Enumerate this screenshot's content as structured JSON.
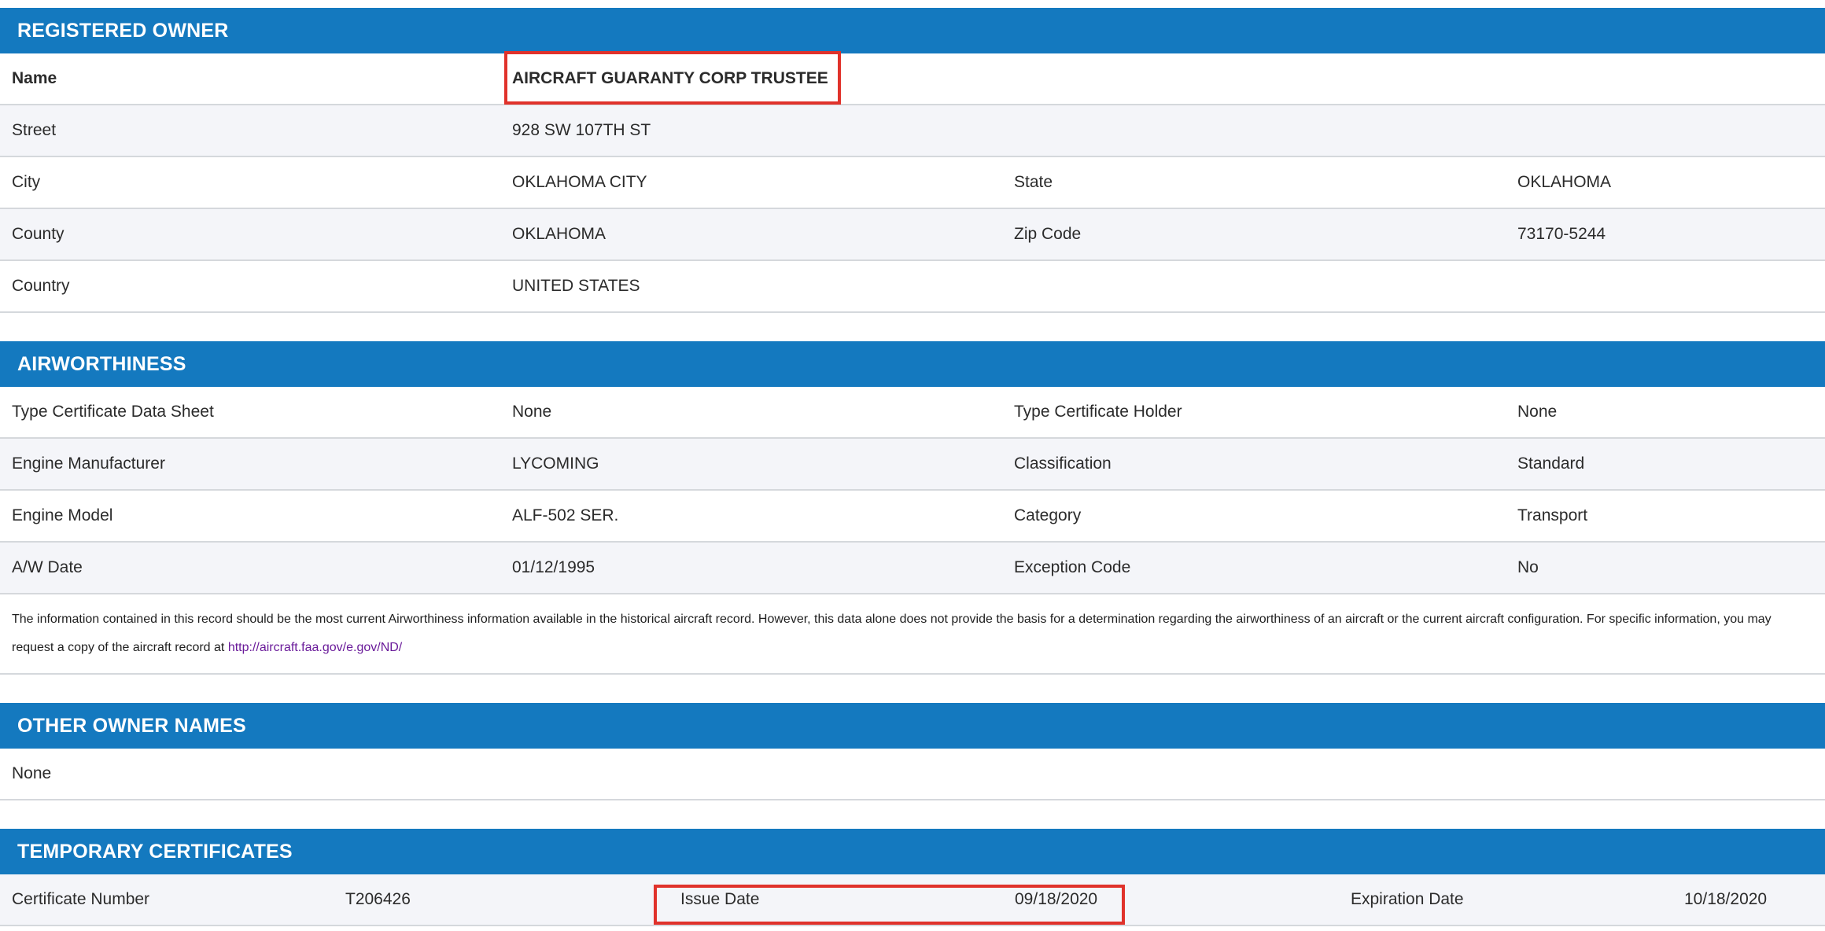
{
  "registered_owner": {
    "header": "REGISTERED OWNER",
    "rows": [
      {
        "l1": "Name",
        "v1": "AIRCRAFT GUARANTY CORP TRUSTEE",
        "l2": "",
        "v2": ""
      },
      {
        "l1": "Street",
        "v1": "928 SW 107TH ST",
        "l2": "",
        "v2": ""
      },
      {
        "l1": "City",
        "v1": "OKLAHOMA CITY",
        "l2": "State",
        "v2": "OKLAHOMA"
      },
      {
        "l1": "County",
        "v1": "OKLAHOMA",
        "l2": "Zip Code",
        "v2": "73170-5244"
      },
      {
        "l1": "Country",
        "v1": "UNITED STATES",
        "l2": "",
        "v2": ""
      }
    ]
  },
  "airworthiness": {
    "header": "AIRWORTHINESS",
    "rows": [
      {
        "l1": "Type Certificate Data Sheet",
        "v1": "None",
        "l2": "Type Certificate Holder",
        "v2": "None"
      },
      {
        "l1": "Engine Manufacturer",
        "v1": "LYCOMING",
        "l2": "Classification",
        "v2": "Standard"
      },
      {
        "l1": "Engine Model",
        "v1": "ALF-502 SER.",
        "l2": "Category",
        "v2": "Transport"
      },
      {
        "l1": "A/W Date",
        "v1": "01/12/1995",
        "l2": "Exception Code",
        "v2": "No"
      }
    ],
    "notice_text": "The information contained in this record should be the most current Airworthiness information available in the historical aircraft record. However, this data alone does not provide the basis for a determination regarding the airworthiness of an aircraft or the current aircraft configuration. For specific information, you may request a copy of the aircraft record at ",
    "notice_link": "http://aircraft.faa.gov/e.gov/ND/"
  },
  "other_owner_names": {
    "header": "OTHER OWNER NAMES",
    "value": "None"
  },
  "temporary_certificates": {
    "header": "TEMPORARY CERTIFICATES",
    "cert_number_label": "Certificate Number",
    "cert_number": "T206426",
    "issue_date_label": "Issue Date",
    "issue_date": "09/18/2020",
    "expiration_date_label": "Expiration Date",
    "expiration_date": "10/18/2020"
  },
  "highlight_color": "#e0322b",
  "header_color": "#1479bf"
}
